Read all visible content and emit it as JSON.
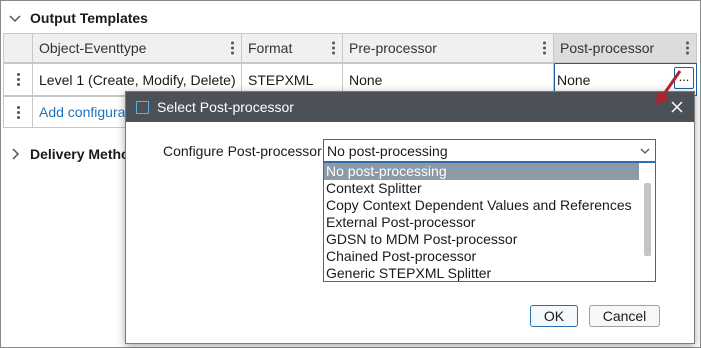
{
  "output_templates": {
    "title": "Output Templates",
    "columns": [
      "Object-Eventtype",
      "Format",
      "Pre-processor",
      "Post-processor"
    ],
    "rows": [
      {
        "object_eventtype": "Level 1 (Create, Modify, Delete)",
        "format": "STEPXML",
        "pre_processor": "None",
        "post_processor": "None",
        "edit_button": "..."
      }
    ],
    "add_link": "Add configura"
  },
  "delivery": {
    "title": "Delivery Metho"
  },
  "dialog": {
    "title": "Select Post-processor",
    "field_label": "Configure Post-processor",
    "selected_value": "No post-processing",
    "options": [
      "No post-processing",
      "Context Splitter",
      "Copy Context Dependent Values and References",
      "External Post-processor",
      "GDSN to MDM Post-processor",
      "Chained Post-processor",
      "Generic STEPXML Splitter"
    ],
    "ok_label": "OK",
    "cancel_label": "Cancel"
  },
  "colors": {
    "titlebar": "#4b5157",
    "focus_border": "#2a6fb0",
    "selected_option": "#8c99a6",
    "link": "#1e73be",
    "annotation_arrow": "#b5202a"
  },
  "icons": [
    "chevron-down-icon",
    "chevron-right-icon",
    "kebab-icon",
    "window-icon",
    "close-icon",
    "dropdown-arrow-icon"
  ]
}
